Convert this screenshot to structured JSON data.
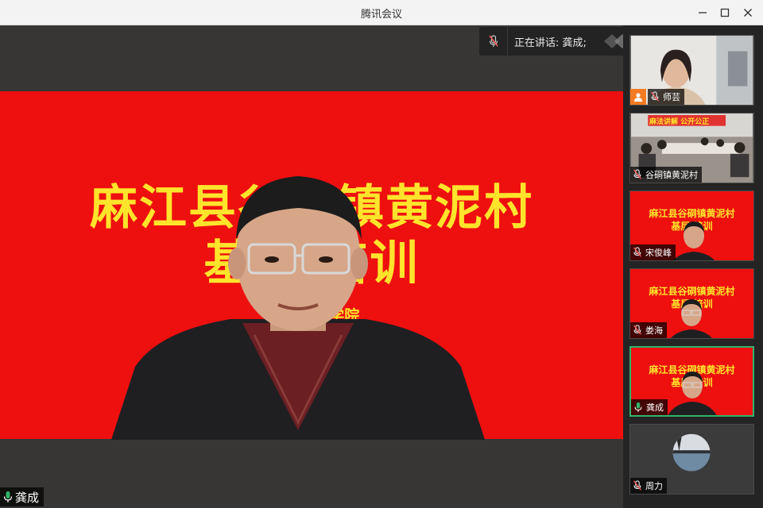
{
  "window": {
    "title": "腾讯会议"
  },
  "main": {
    "banner": {
      "line1": "麻江县谷硐镇黄泥村",
      "line2": "基层    培训",
      "line3": "主办：                              理学院"
    },
    "speaker_name": "龚成"
  },
  "speaking": {
    "label": "正在讲话: 龚成;"
  },
  "participants": [
    {
      "name": "师芸",
      "mic": "off",
      "host": true
    },
    {
      "name": "谷硐镇黄泥村",
      "mic": "off",
      "mini_banner": "麻法讲解  公开公正"
    },
    {
      "name": "宋俊峰",
      "mic": "off",
      "banner1": "麻江县谷硐镇黄泥村",
      "banner2": "基层    培训"
    },
    {
      "name": "娄海",
      "mic": "off",
      "banner1": "麻江县谷硐镇黄泥村",
      "banner2": "基层    培训"
    },
    {
      "name": "龚成",
      "mic": "on",
      "active": true,
      "banner1": "麻江县谷硐镇黄泥村",
      "banner2": "基层    培训"
    },
    {
      "name": "周力",
      "mic": "off"
    }
  ],
  "colors": {
    "banner_red": "#ee0f0f",
    "banner_yellow": "#ffe42b",
    "active_border": "#2fb36a",
    "host_badge": "#f47b22",
    "mic_on": "#2fb36a",
    "mic_off": "#ff5a5a"
  },
  "icons": {
    "minimize": "minimize-icon",
    "maximize": "maximize-icon",
    "close": "close-icon",
    "mic": "microphone-icon",
    "mic_off": "microphone-muted-icon",
    "reply": "reply-icon",
    "host": "host-user-icon"
  }
}
